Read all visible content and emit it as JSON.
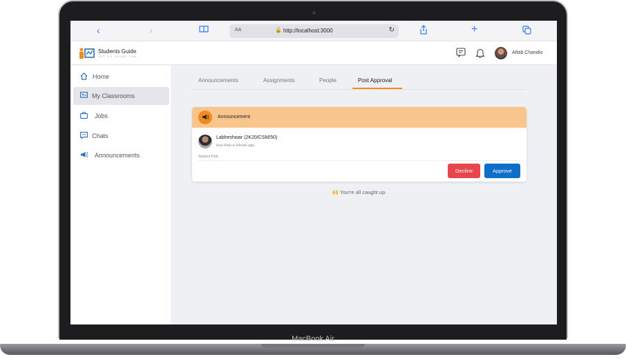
{
  "device": {
    "model_label": "MacBook Air"
  },
  "browser": {
    "back_icon": "chevron-left-icon",
    "forward_icon": "chevron-right-icon",
    "reader_icon": "book-icon",
    "text_size_label": "AA",
    "url": "http://localhost:3000",
    "share_icon": "share-icon",
    "new_tab_icon": "plus-icon",
    "tabs_icon": "tabs-icon"
  },
  "header": {
    "logo_title": "Students Guide",
    "logo_subtitle": "LET US GUIDE YOU",
    "user_name": "Aftab Chandio",
    "accent": "#f28b1e",
    "logo_color": "#2f6fb5"
  },
  "sidebar": {
    "items": [
      {
        "label": "Home",
        "icon": "home-icon",
        "active": false
      },
      {
        "label": "My Classrooms",
        "icon": "classroom-icon",
        "active": true
      },
      {
        "label": "Jobs",
        "icon": "briefcase-icon",
        "active": false
      },
      {
        "label": "Chats",
        "icon": "chat-icon",
        "active": false
      },
      {
        "label": "Announcements",
        "icon": "megaphone-icon",
        "active": false
      }
    ]
  },
  "tabs": [
    {
      "label": "Announcements",
      "active": false
    },
    {
      "label": "Assignments",
      "active": false
    },
    {
      "label": "People",
      "active": false
    },
    {
      "label": "Post Approval",
      "active": true
    }
  ],
  "post": {
    "category": "Announcement",
    "author": "Labheshwar (2K20/CSM/50)",
    "time": "less than a minute ago",
    "type": "Student Post",
    "decline_label": "Decline",
    "approve_label": "Approve",
    "header_color": "#f9c58d",
    "decline_color": "#e5474d",
    "approve_color": "#0e6ec9"
  },
  "status": {
    "icon": "raised-hands-icon",
    "text": "You're all caught up."
  }
}
